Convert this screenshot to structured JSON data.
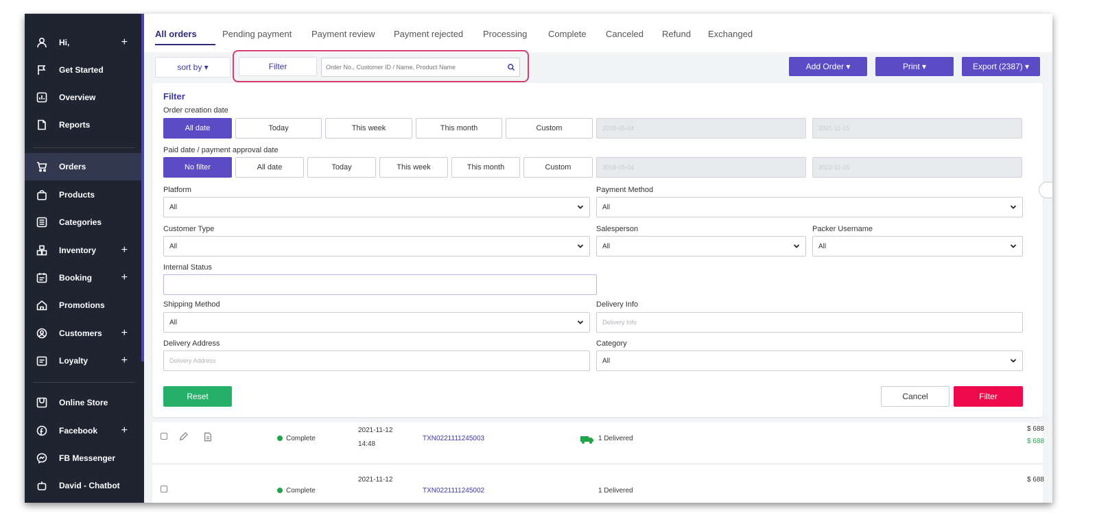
{
  "sidebar": {
    "items": [
      {
        "label": "Hi,",
        "icon": "user-icon",
        "plus": "+"
      },
      {
        "label": "Get Started",
        "icon": "flag-icon"
      },
      {
        "label": "Overview",
        "icon": "chart-icon"
      },
      {
        "label": "Reports",
        "icon": "document-icon"
      },
      {
        "label": "Orders",
        "icon": "cart-icon"
      },
      {
        "label": "Products",
        "icon": "bag-icon"
      },
      {
        "label": "Categories",
        "icon": "list-icon"
      },
      {
        "label": "Inventory",
        "icon": "boxes-icon",
        "plus": "+"
      },
      {
        "label": "Booking",
        "icon": "calendar-icon",
        "plus": "+"
      },
      {
        "label": "Promotions",
        "icon": "home-icon"
      },
      {
        "label": "Customers",
        "icon": "person-circle-icon",
        "plus": "+"
      },
      {
        "label": "Loyalty",
        "icon": "card-icon",
        "plus": "+"
      },
      {
        "label": "Online Store",
        "icon": "store-icon"
      },
      {
        "label": "Facebook",
        "icon": "facebook-icon",
        "plus": "+"
      },
      {
        "label": "FB Messenger",
        "icon": "messenger-icon"
      },
      {
        "label": "David - Chatbot",
        "icon": "bot-icon"
      }
    ]
  },
  "tabs": [
    "All orders",
    "Pending payment",
    "Payment review",
    "Payment rejected",
    "Processing",
    "Complete",
    "Canceled",
    "Refund",
    "Exchanged"
  ],
  "toolbar": {
    "sort_label": "sort by ▾",
    "filter_label": "Filter",
    "search_placeholder": "Order No., Customer ID / Name, Product Name",
    "add_order_label": "Add Order ▾",
    "print_label": "Print ▾",
    "export_label": "Export (2387) ▾"
  },
  "filter": {
    "title": "Filter",
    "order_creation": {
      "label": "Order creation date",
      "options": [
        "All date",
        "Today",
        "This week",
        "This month",
        "Custom"
      ],
      "selected": "All date",
      "from": "2018-05-04",
      "to": "2021-11-15"
    },
    "paid_date": {
      "label": "Paid date / payment approval date",
      "options": [
        "No filter",
        "All date",
        "Today",
        "This week",
        "This month",
        "Custom"
      ],
      "selected": "No filter",
      "from": "2018-05-04",
      "to": "2021-11-15"
    },
    "platform": {
      "label": "Platform",
      "value": "All"
    },
    "payment_method": {
      "label": "Payment Method",
      "value": "All"
    },
    "customer_type": {
      "label": "Customer Type",
      "value": "All"
    },
    "salesperson": {
      "label": "Salesperson",
      "value": "All"
    },
    "packer_username": {
      "label": "Packer Username",
      "value": "All"
    },
    "internal_status": {
      "label": "Internal Status",
      "value": ""
    },
    "shipping_method": {
      "label": "Shipping Method",
      "value": "All"
    },
    "delivery_info": {
      "label": "Delivery Info",
      "placeholder": "Delivery Info"
    },
    "delivery_address": {
      "label": "Delivery Address",
      "placeholder": "Delivery Address"
    },
    "category": {
      "label": "Category",
      "value": "All"
    },
    "reset_label": "Reset",
    "cancel_label": "Cancel",
    "apply_label": "Filter"
  },
  "orders": [
    {
      "status": "Complete",
      "date": "2021-11-12",
      "time": "14:48",
      "txn": "TXN0221111245003",
      "delivery": "1 Delivered",
      "amount": "$ 688",
      "amount2": "$ 688"
    },
    {
      "status": "Complete",
      "date": "2021-11-12",
      "time": "",
      "txn": "TXN0221111245002",
      "delivery": "1 Delivered",
      "amount": "$ 688",
      "amount2": ""
    }
  ],
  "colors": {
    "accent": "#5b4bc4",
    "danger": "#ee0a4a",
    "sidebar": "#1f2431",
    "success": "#22a54a"
  }
}
